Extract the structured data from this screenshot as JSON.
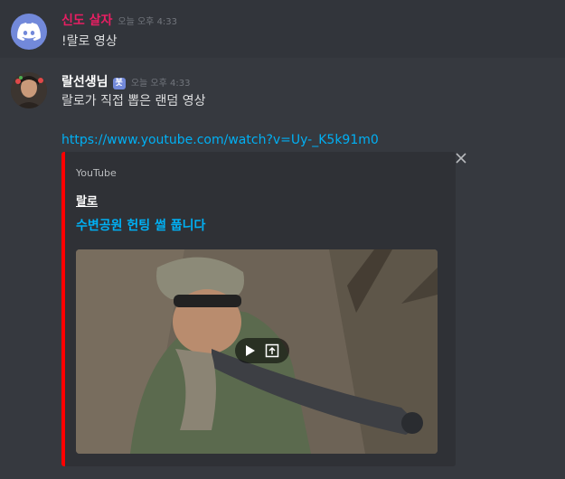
{
  "messages": [
    {
      "username": "신도 살자",
      "timestamp": "오늘 오후 4:33",
      "content": "!랄로 영상"
    },
    {
      "username": "랄선생님",
      "bot_tag": "봇",
      "timestamp": "오늘 오후 4:33",
      "content": "랄로가 직접 뽑은 랜덤 영상",
      "link": "https://www.youtube.com/watch?v=Uy-_K5k91m0",
      "embed": {
        "provider": "YouTube",
        "author": "랄로",
        "title": "수변공원 헌팅 썰 풉니다",
        "color": "#ff0000"
      }
    }
  ],
  "icons": {
    "avatar_1": "discord-logo-icon",
    "play": "play-icon",
    "external": "open-external-icon",
    "close": "close-icon"
  },
  "colors": {
    "background": "#36393f",
    "username_1": "#e91e63",
    "link": "#00b0f4",
    "bot_tag": "#7289da"
  }
}
